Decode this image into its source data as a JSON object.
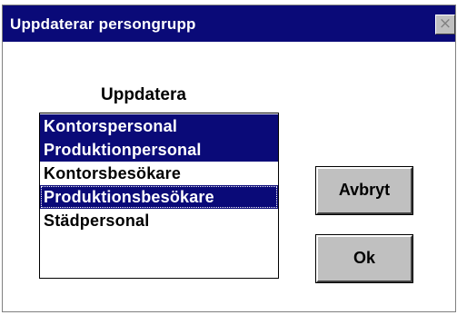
{
  "window": {
    "title": "Uppdaterar persongrupp",
    "close_label": "×"
  },
  "main": {
    "heading": "Uppdatera",
    "list": {
      "items": [
        {
          "label": "Kontorspersonal",
          "selected": true,
          "focused": false
        },
        {
          "label": "Produktionpersonal",
          "selected": true,
          "focused": false
        },
        {
          "label": "Kontorsbesökare",
          "selected": false,
          "focused": false
        },
        {
          "label": "Produktionsbesökare",
          "selected": true,
          "focused": true
        },
        {
          "label": "Städpersonal",
          "selected": false,
          "focused": false
        }
      ]
    }
  },
  "buttons": {
    "cancel_label": "Avbryt",
    "ok_label": "Ok"
  },
  "colors": {
    "titlebar": "#0a0a78",
    "selection": "#0a0a78",
    "button_face": "#c0c0c0"
  }
}
